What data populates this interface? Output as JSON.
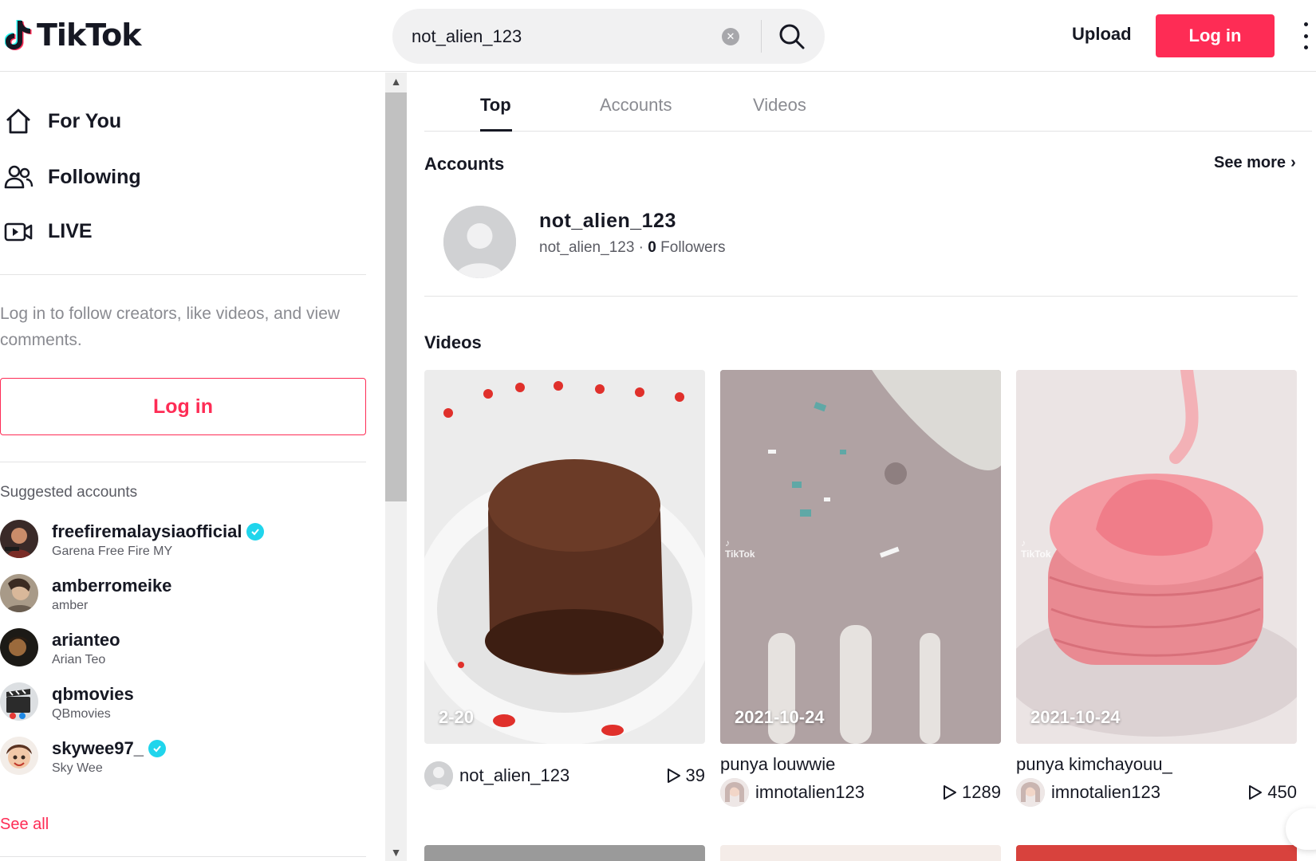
{
  "header": {
    "logo_text": "TikTok",
    "search_value": "not_alien_123",
    "upload_label": "Upload",
    "login_label": "Log in"
  },
  "sidebar": {
    "nav": [
      {
        "label": "For You",
        "icon": "home-icon"
      },
      {
        "label": "Following",
        "icon": "following-icon"
      },
      {
        "label": "LIVE",
        "icon": "live-icon"
      }
    ],
    "login_prompt": "Log in to follow creators, like videos, and view comments.",
    "login_label": "Log in",
    "suggested_title": "Suggested accounts",
    "accounts": [
      {
        "username": "freefiremalaysiaofficial",
        "nickname": "Garena Free Fire MY",
        "verified": true
      },
      {
        "username": "amberromeike",
        "nickname": "amber",
        "verified": false
      },
      {
        "username": "arianteo",
        "nickname": "Arian Teo",
        "verified": false
      },
      {
        "username": "qbmovies",
        "nickname": "QBmovies",
        "verified": false
      },
      {
        "username": "skywee97_",
        "nickname": "Sky Wee",
        "verified": true
      }
    ],
    "see_all": "See all"
  },
  "main": {
    "tabs": [
      "Top",
      "Accounts",
      "Videos"
    ],
    "active_tab": "Top",
    "accounts_title": "Accounts",
    "see_more": "See more",
    "account": {
      "name": "not_alien_123",
      "handle": "not_alien_123",
      "followers_count": "0",
      "followers_label": "Followers"
    },
    "videos_title": "Videos",
    "videos": [
      {
        "date": "2-20",
        "caption": "",
        "user": "not_alien_123",
        "plays": "39"
      },
      {
        "date": "2021-10-24",
        "caption": "punya louwwie",
        "user": "imnotalien123",
        "plays": "1289"
      },
      {
        "date": "2021-10-24",
        "caption": "punya kimchayouu_",
        "user": "imnotalien123",
        "plays": "450"
      }
    ],
    "watermarks": [
      "TikTok",
      "TikTok"
    ]
  },
  "colors": {
    "brand": "#fe2c55",
    "verified": "#20d5ec",
    "text": "#161823",
    "muted": "#8a8b91"
  }
}
